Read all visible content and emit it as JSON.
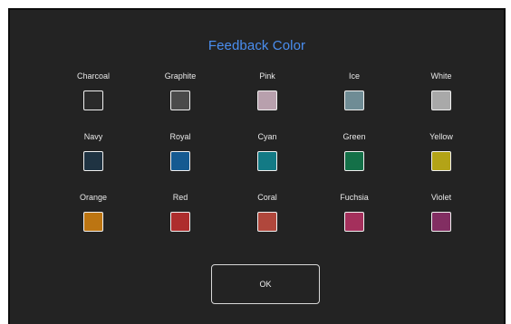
{
  "dialog": {
    "title": "Feedback Color",
    "ok_label": "OK"
  },
  "swatches": [
    [
      {
        "label": "Charcoal",
        "color": "#2a2a2a"
      },
      {
        "label": "Graphite",
        "color": "#4a4a4a"
      },
      {
        "label": "Pink",
        "color": "#b8a0ad"
      },
      {
        "label": "Ice",
        "color": "#6f8c95"
      },
      {
        "label": "White",
        "color": "#a9a9a9"
      }
    ],
    [
      {
        "label": "Navy",
        "color": "#1f3342"
      },
      {
        "label": "Royal",
        "color": "#155a91"
      },
      {
        "label": "Cyan",
        "color": "#137a85"
      },
      {
        "label": "Green",
        "color": "#147048"
      },
      {
        "label": "Yellow",
        "color": "#b3a317"
      }
    ],
    [
      {
        "label": "Orange",
        "color": "#bc7512"
      },
      {
        "label": "Red",
        "color": "#ae2d2d"
      },
      {
        "label": "Coral",
        "color": "#b0473c"
      },
      {
        "label": "Fuchsia",
        "color": "#a4305c"
      },
      {
        "label": "Violet",
        "color": "#822e62"
      }
    ]
  ]
}
